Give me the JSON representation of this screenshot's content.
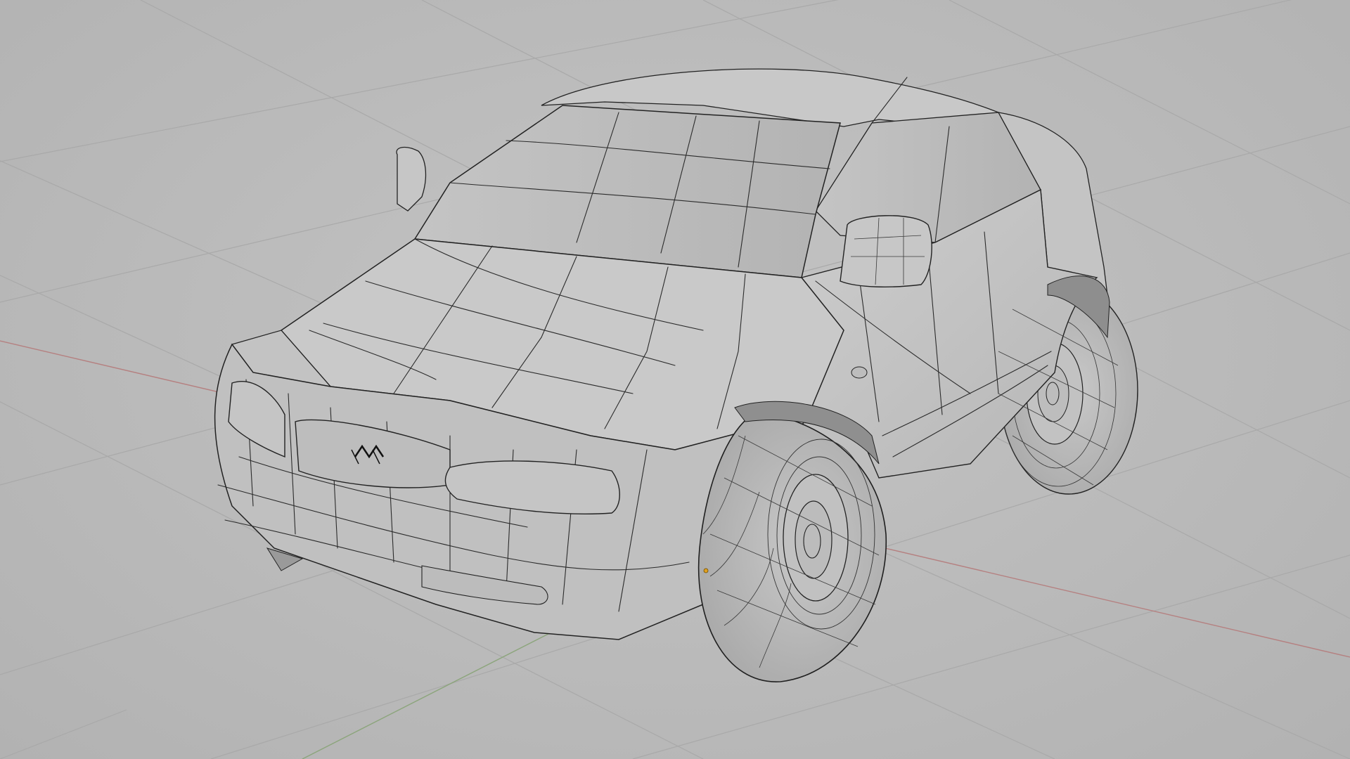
{
  "app": {
    "view": "3D viewport",
    "shading": "solid",
    "overlay": "wireframe"
  },
  "colors": {
    "background": "#bcbcbc",
    "grid_line": "#a9a9a9",
    "axis_x": "#b07a7a",
    "axis_y": "#8aa37a",
    "mesh_fill": "#c6c6c6",
    "mesh_edge": "#2b2b2b",
    "object_origin": "#e0a020"
  },
  "scene": {
    "object": "car-model",
    "emblem": "car-emblem"
  }
}
